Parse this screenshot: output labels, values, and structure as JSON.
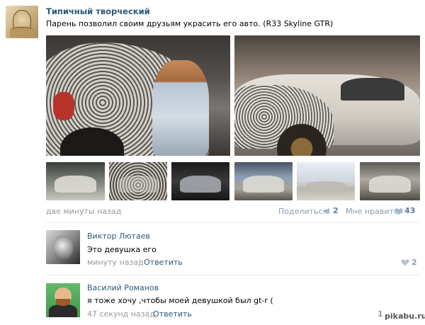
{
  "post": {
    "group_name": "Типичный творческий",
    "text": "Парень позволил своим друзьям украсить его авто. (R33 Skyline GTR)",
    "time": "две минуты назад",
    "share_label": "Поделиться",
    "share_count": "2",
    "like_label": "Мне нравится",
    "like_count": "43",
    "images": [
      "car-closeup-with-artist",
      "car-side-view",
      "thumb-1",
      "thumb-2",
      "thumb-3",
      "thumb-4",
      "thumb-5",
      "thumb-6"
    ]
  },
  "comments": [
    {
      "author": "Виктор Лютаев",
      "text": "Это девушка его",
      "time": "минуту назад",
      "separator": "|",
      "reply_label": "Ответить",
      "like_count": "2"
    },
    {
      "author": "Василий Романов",
      "text": "я тоже хочу ,чтобы моей девушкой был gt-r (",
      "time": "47 секунд назад",
      "separator": "|",
      "reply_label": "Ответить",
      "like_count": "1"
    }
  ],
  "watermark": "pikabu.ru",
  "icons": {
    "share": "megaphone-icon",
    "like": "heart-icon"
  },
  "colors": {
    "link": "#2b587a",
    "muted": "#999999",
    "counter": "#5b7b99"
  }
}
